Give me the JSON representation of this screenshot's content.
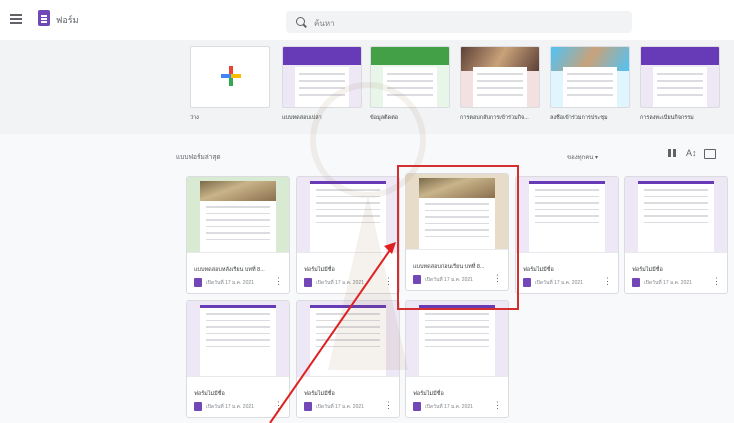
{
  "app": {
    "title": "ฟอร์ม"
  },
  "search": {
    "placeholder": "ค้นหา"
  },
  "templates": [
    {
      "name": "ว่าง",
      "kind": "blank"
    },
    {
      "name": "แบบทดสอบเปล่า",
      "kind": "purple"
    },
    {
      "name": "ข้อมูลติดต่อ",
      "kind": "green"
    },
    {
      "name": "การตอบกลับการเข้าร่วมกิจ...",
      "kind": "photo"
    },
    {
      "name": "ลงชื่อเข้าร่วมการประชุม",
      "kind": "photo2"
    },
    {
      "name": "การลงทะเบียนกิจกรรม",
      "kind": "purple2"
    }
  ],
  "recent": {
    "title": "แบบฟอร์มล่าสุด",
    "owner_filter": "ของทุกคน ▾"
  },
  "cards": [
    {
      "title": "แบบทดสอบหลังเรียน บทที่ 8...",
      "date": "เปิดวันที่ 17 ม.ค. 2021",
      "bg": "#d9ead3",
      "photo": true
    },
    {
      "title": "ฟอร์มไม่มีชื่อ",
      "date": "เปิดวันที่ 17 ม.ค. 2021",
      "bg": "#ede7f6",
      "photo": false
    },
    {
      "title": "แบบทดสอบก่อนเรียน บทที่ 8...",
      "date": "เปิดวันที่ 17 ม.ค. 2021",
      "bg": "#e6dcc8",
      "photo": true
    },
    {
      "title": "ฟอร์มไม่มีชื่อ",
      "date": "เปิดวันที่ 17 ม.ค. 2021",
      "bg": "#ede7f6",
      "photo": false
    },
    {
      "title": "ฟอร์มไม่มีชื่อ",
      "date": "เปิดวันที่ 17 ม.ค. 2021",
      "bg": "#ede7f6",
      "photo": false
    },
    {
      "title": "ฟอร์มไม่มีชื่อ",
      "date": "เปิดวันที่ 17 ม.ค. 2021",
      "bg": "#ede7f6",
      "photo": false
    },
    {
      "title": "ฟอร์มไม่มีชื่อ",
      "date": "เปิดวันที่ 17 ม.ค. 2021",
      "bg": "#ede7f6",
      "photo": false
    },
    {
      "title": "ฟอร์มไม่มีชื่อ",
      "date": "เปิดวันที่ 17 ม.ค. 2021",
      "bg": "#ede7f6",
      "photo": false
    }
  ],
  "colors": {
    "accent": "#673ab7",
    "highlight": "#d32f2f"
  }
}
